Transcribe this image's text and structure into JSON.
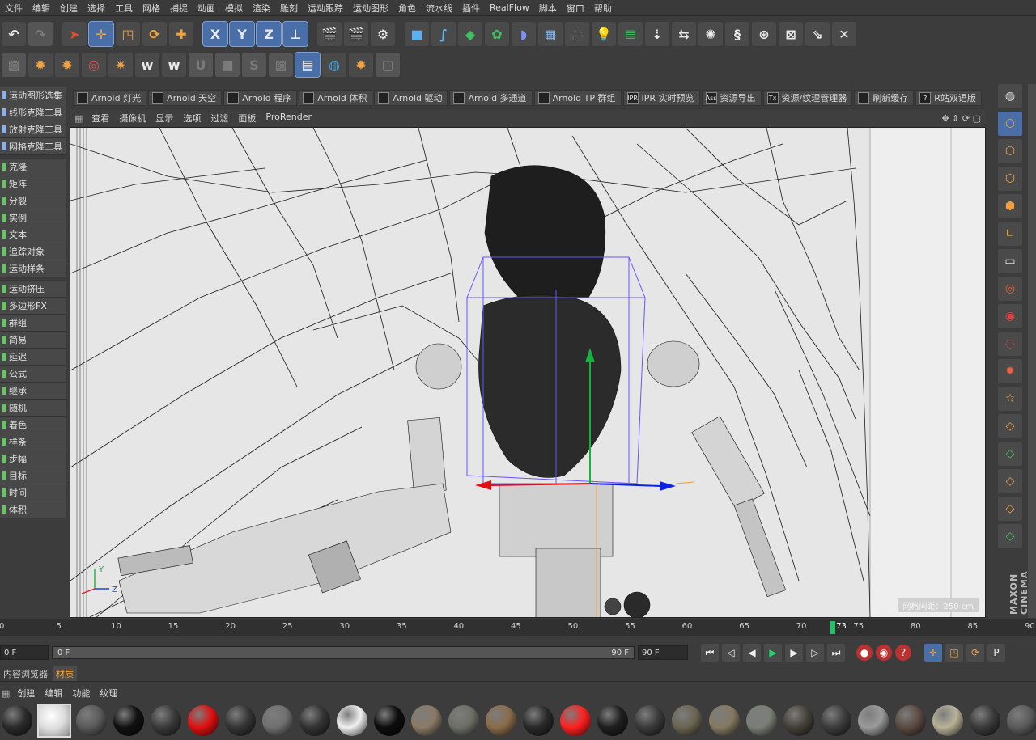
{
  "menu": [
    "文件",
    "编辑",
    "创建",
    "选择",
    "工具",
    "网格",
    "捕捉",
    "动画",
    "模拟",
    "渲染",
    "雕刻",
    "运动跟踪",
    "运动图形",
    "角色",
    "流水线",
    "插件",
    "RealFlow",
    "脚本",
    "窗口",
    "帮助"
  ],
  "toolbar_axes": [
    "X",
    "Y",
    "Z"
  ],
  "plugins": [
    {
      "icon": "bulb-icon",
      "label": "Arnold 灯光"
    },
    {
      "icon": "globe-icon",
      "label": "Arnold 天空"
    },
    {
      "icon": "cube-icon",
      "label": "Arnold 程序"
    },
    {
      "icon": "volume-icon",
      "label": "Arnold 体积"
    },
    {
      "icon": "document-icon",
      "label": "Arnold 驱动"
    },
    {
      "icon": "layers-icon",
      "label": "Arnold 多通道"
    },
    {
      "icon": "particles-icon",
      "label": "Arnold TP 群组"
    },
    {
      "icon": "ipr-icon",
      "glyph": "IPR",
      "label": "IPR 实时预览"
    },
    {
      "icon": "ass-icon",
      "glyph": "Ass",
      "label": "资源导出"
    },
    {
      "icon": "tx-icon",
      "glyph": "Tx",
      "label": "资源/纹理管理器"
    },
    {
      "icon": "trash-icon",
      "label": "刷新缓存"
    },
    {
      "icon": "help-icon",
      "glyph": "?",
      "label": "R站双语版"
    }
  ],
  "left_tools": {
    "group1": [
      "运动图形选集",
      "线形克隆工具",
      "放射克隆工具",
      "网格克隆工具"
    ],
    "group2": [
      "克隆",
      "矩阵",
      "分裂",
      "实例",
      "文本",
      "追踪对象",
      "运动样条"
    ],
    "group3": [
      "运动挤压",
      "多边形FX",
      "群组",
      "简易",
      "延迟",
      "公式",
      "继承",
      "随机",
      "着色",
      "样条",
      "步幅",
      "目标",
      "时间",
      "体积"
    ]
  },
  "viewport_menu": [
    "查看",
    "摄像机",
    "显示",
    "选项",
    "过滤",
    "面板",
    "ProRender"
  ],
  "viewport_status": "网格间距：250 cm",
  "axis_labels": {
    "y": "Y",
    "z": "Z"
  },
  "timeline": {
    "ticks": [
      0,
      5,
      10,
      15,
      20,
      25,
      30,
      35,
      40,
      45,
      50,
      55,
      60,
      65,
      70,
      75,
      80,
      85,
      90
    ],
    "current_frame": 73,
    "max": 90
  },
  "playback": {
    "start_field": "0 F",
    "range_start": "0 F",
    "range_end": "90 F",
    "end_field": "90 F"
  },
  "material_tabs": [
    "内容浏览器",
    "材质"
  ],
  "material_menu": [
    "创建",
    "编辑",
    "功能",
    "纹理"
  ],
  "brand": "MAXON CINEMA",
  "materials": [
    "#2b2b2b",
    "#e8e8e8",
    "#5a5a5a",
    "#111111",
    "#3a3a3a",
    "#e01010",
    "#353535",
    "#707070",
    "#333333",
    "#f0f0f0",
    "#0d0d0d",
    "#8a7a66",
    "#6c6f66",
    "#8a6c4a",
    "#2a2a2a",
    "#ff2020",
    "#1f1f1f",
    "#3a3a3a",
    "#6a6552",
    "#847a62",
    "#7a7f76",
    "#444038",
    "#3c3c3c",
    "#9a9a9a",
    "#5b4a42",
    "#b9b298",
    "#3a3a3a",
    "#5a5a5a"
  ],
  "colors": {
    "accent": "#f2a340",
    "selection": "#4a6ea8",
    "play": "#28d070",
    "playhead": "#22c06a"
  }
}
